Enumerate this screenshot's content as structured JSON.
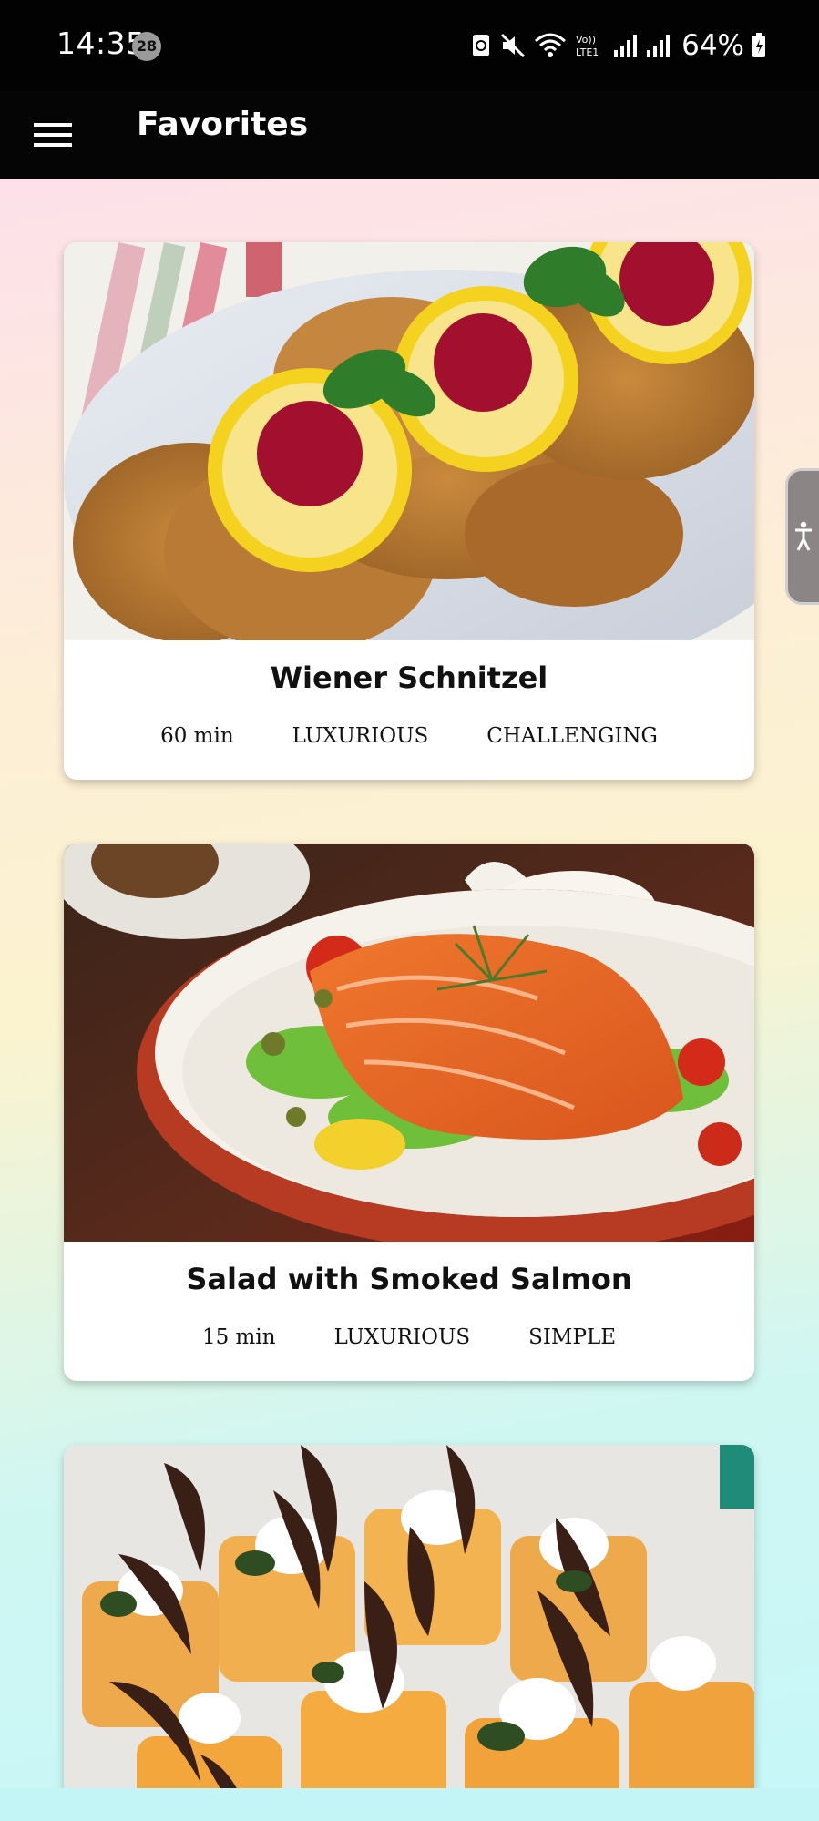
{
  "status_bar": {
    "time": "14:35",
    "notification_count": "28",
    "battery": "64%"
  },
  "app_bar": {
    "title": "Favorites"
  },
  "meals": [
    {
      "title": "Wiener Schnitzel",
      "duration": "60 min",
      "affordability": "LUXURIOUS",
      "complexity": "CHALLENGING"
    },
    {
      "title": "Salad with Smoked Salmon",
      "duration": "15 min",
      "affordability": "LUXURIOUS",
      "complexity": "SIMPLE"
    },
    {
      "title": "",
      "duration": "",
      "affordability": "",
      "complexity": ""
    }
  ],
  "icons": {
    "menu": "menu-icon",
    "accessibility": "accessibility-icon"
  },
  "colors": {
    "app_bar": "#050505",
    "card_background": "#ffffff",
    "gradient_top": "#fde0ea",
    "gradient_bottom": "#c7f7f9"
  }
}
